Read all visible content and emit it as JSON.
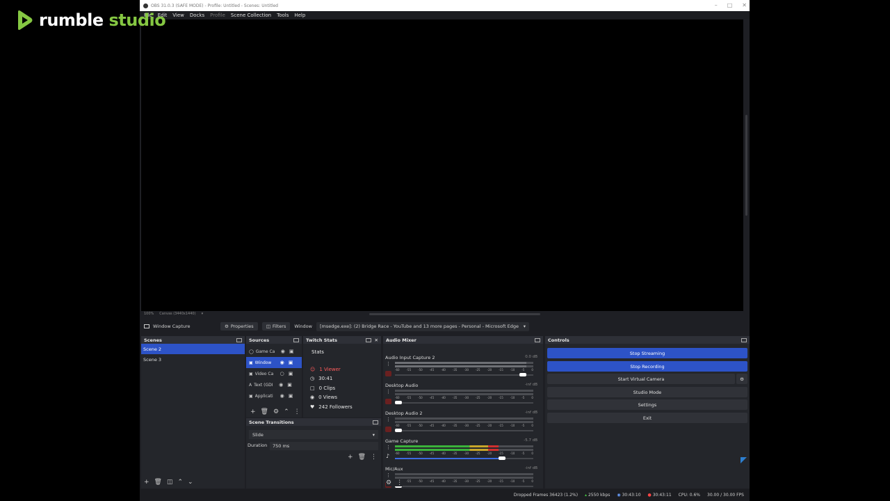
{
  "overlay": {
    "brand_part1": "rumble",
    "brand_part2": "studio",
    "accent": "#85c742"
  },
  "window": {
    "title": "OBS 31.0.3 (SAFE MODE) - Profile: Untitled - Scenes: Untitled",
    "menu": [
      "File",
      "Edit",
      "View",
      "Docks",
      "Profile",
      "Scene Collection",
      "Tools",
      "Help"
    ]
  },
  "preview": {
    "zoom": "100%",
    "canvas": "Canvas (3440x1440)"
  },
  "toolbar": {
    "source_name": "Window Capture",
    "properties_label": "Properties",
    "filters_label": "Filters",
    "window_label": "Window",
    "window_value": "[msedge.exe]: (2) Bridge Race - YouTube and 13 more pages - Personal - Microsoft Edge"
  },
  "scenes": {
    "title": "Scenes",
    "items": [
      {
        "label": "Scene 2",
        "selected": true
      },
      {
        "label": "Scene 3",
        "selected": false
      }
    ]
  },
  "sources": {
    "title": "Sources",
    "items": [
      {
        "label": "Game Ca",
        "selected": false
      },
      {
        "label": "Window",
        "selected": true
      },
      {
        "label": "Video Ca",
        "selected": false
      },
      {
        "label": "Text (GDI",
        "selected": false
      },
      {
        "label": "Applicati",
        "selected": false
      }
    ]
  },
  "twitch": {
    "title": "Twitch Stats",
    "stats_label": "Stats",
    "viewers": "1 Viewer",
    "uptime": "30:41",
    "clips": "0 Clips",
    "views": "0 Views",
    "followers": "242 Followers"
  },
  "transitions": {
    "title": "Scene Transitions",
    "value": "Slide",
    "duration_label": "Duration",
    "duration_value": "750 ms"
  },
  "mixer": {
    "title": "Audio Mixer",
    "ticks": [
      "-60",
      "-55",
      "-50",
      "-45",
      "-40",
      "-35",
      "-30",
      "-25",
      "-20",
      "-15",
      "-10",
      "-5",
      "0"
    ],
    "channels": [
      {
        "name": "Audio Input Capture 2",
        "db": "0.0 dB",
        "level": 0.95,
        "muted": true
      },
      {
        "name": "Desktop Audio",
        "db": "-inf dB",
        "level": 0.0,
        "muted": true
      },
      {
        "name": "Desktop Audio 2",
        "db": "-inf dB",
        "level": 0.0,
        "muted": true
      },
      {
        "name": "Game Capture",
        "db": "-5.7 dB",
        "level": 0.75,
        "muted": false
      },
      {
        "name": "Mic/Aux",
        "db": "-inf dB",
        "level": 0.0,
        "muted": true
      }
    ]
  },
  "controls": {
    "title": "Controls",
    "stop_streaming": "Stop Streaming",
    "stop_recording": "Stop Recording",
    "start_virtual_camera": "Start Virtual Camera",
    "studio_mode": "Studio Mode",
    "settings": "Settings",
    "exit": "Exit"
  },
  "status": {
    "dropped_frames": "Dropped Frames 36423 (1.2%)",
    "bitrate": "2550 kbps",
    "stream_time": "30:43:10",
    "record_time": "30:43:11",
    "cpu": "CPU: 0.6%",
    "fps": "30.00 / 30.00 FPS"
  }
}
